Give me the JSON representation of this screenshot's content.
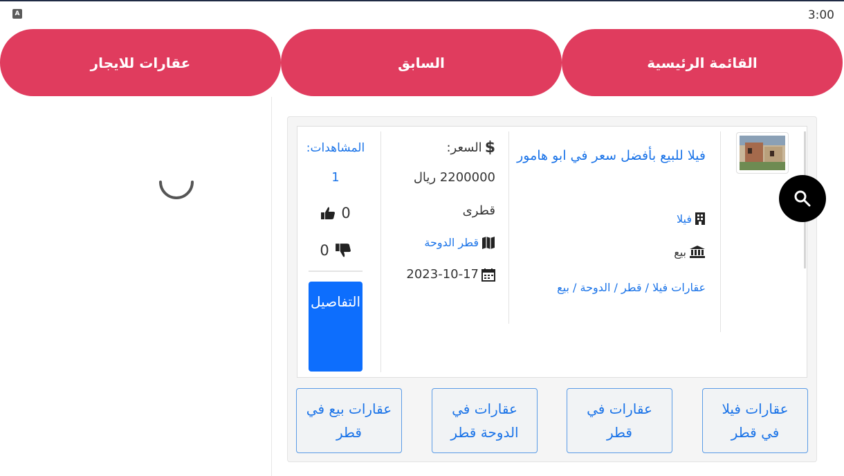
{
  "status_bar": {
    "app_icon": "A",
    "time": "3:00"
  },
  "nav": {
    "home_label": "القائمة الرئيسية",
    "prev_label": "السابق",
    "rent_label": "عقارات للايجار"
  },
  "listing": {
    "title": "فيلا للبيع بأفضل سعر في ابو هامور",
    "category": "فيلا",
    "type": "بيع",
    "breadcrumb": "عقارات فيلا / قطر / الدوحة / بيع",
    "price_label": "السعر:",
    "price_value": "2200000 ريال قطرى",
    "location": "قطر الدوحة",
    "date": "2023-10-17",
    "views_label": "المشاهدات:",
    "views_count": "1",
    "likes": "0",
    "dislikes": "0",
    "details_label": "التفاصيل"
  },
  "tags": [
    "عقارات فيلا في قطر",
    "عقارات في قطر",
    "عقارات في الدوحة قطر",
    "عقارات بيع في قطر"
  ],
  "icons": {
    "status_app": "app-letter-icon",
    "spinner": "loading-spinner-icon",
    "search": "search-icon",
    "dollar": "dollar-icon",
    "map": "map-icon",
    "calendar": "calendar-icon",
    "building": "building-icon",
    "bank": "bank-icon",
    "thumbs_up": "thumbs-up-icon",
    "thumbs_down": "thumbs-down-icon"
  },
  "colors": {
    "nav_bg": "#e03c5e",
    "link": "#1a73e8",
    "primary_button": "#0d6efd",
    "fab": "#000000"
  }
}
